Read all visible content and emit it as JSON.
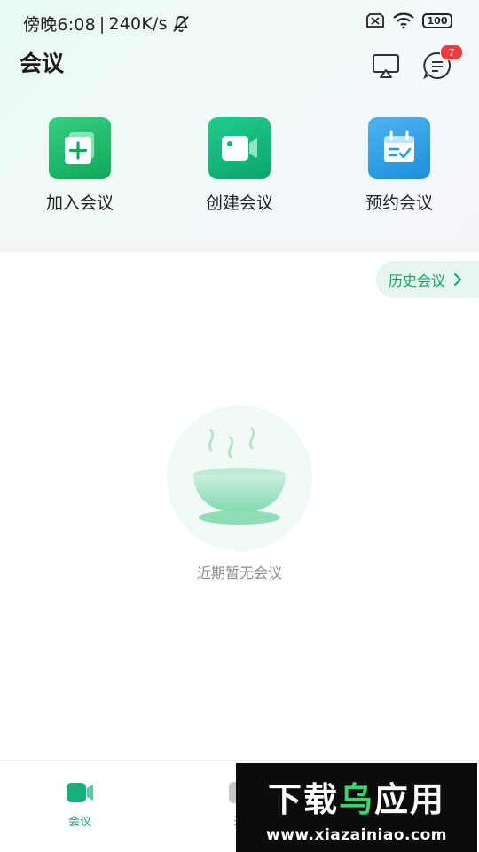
{
  "status_bar": {
    "time": "傍晚6:08",
    "speed": "240K/s",
    "battery": "100"
  },
  "header": {
    "title": "会议",
    "message_badge": "7"
  },
  "actions": [
    {
      "label": "加入会议",
      "icon": "plus-square-icon",
      "color": "#1fb868"
    },
    {
      "label": "创建会议",
      "icon": "video-camera-icon",
      "color": "#12b67a"
    },
    {
      "label": "预约会议",
      "icon": "calendar-check-icon",
      "color": "#2f9fe6"
    }
  ],
  "history": {
    "label": "历史会议"
  },
  "empty_state": {
    "text": "近期暂无会议"
  },
  "bottom_nav": {
    "items": [
      {
        "label": "会议",
        "icon": "video-camera-icon",
        "active": true
      },
      {
        "label": "通",
        "icon": "contacts-icon",
        "active": false
      }
    ]
  },
  "watermark": {
    "title_part1": "下载",
    "title_part2": "乌",
    "title_part3": "应用",
    "url": "www.xiazainiao.com"
  },
  "colors": {
    "accent": "#16a36a",
    "badge": "#e84040"
  }
}
